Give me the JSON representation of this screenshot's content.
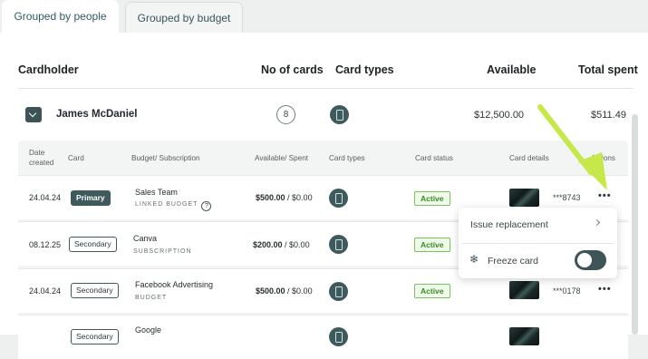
{
  "tabs": [
    {
      "label": "Grouped by people"
    },
    {
      "label": "Grouped by budget"
    }
  ],
  "table": {
    "headers": {
      "cardholder": "Cardholder",
      "no_of_cards": "No of cards",
      "card_types": "Card types",
      "available": "Available",
      "total_spent": "Total spent"
    }
  },
  "cardholder": {
    "name": "James McDaniel",
    "card_count": "8",
    "available": "$12,500.00",
    "total_spent": "$511.49"
  },
  "subtable": {
    "headers": {
      "date_created_1": "Date",
      "date_created_2": "created",
      "card": "Card",
      "budget_subscription": "Budget/ Subscription",
      "available_spent": "Available/ Spent",
      "card_types": "Card types",
      "card_status": "Card status",
      "card_details": "Card details",
      "actions": "Actions"
    },
    "rows": [
      {
        "date": "24.04.24",
        "card": "Primary",
        "budget": "Sales Team",
        "budget_type": "LINKED BUDGET",
        "help": "?",
        "available": "$500.00",
        "spent": " / $0.00",
        "status": "Active",
        "card_number": "***8743",
        "actions": "•••"
      },
      {
        "date": "08.12.25",
        "card": "Secondary",
        "budget": "Canva",
        "budget_type": "SUBSCRIPTION",
        "available": "$200.00",
        "spent": " / $0.00",
        "status": "Active"
      },
      {
        "date": "24.04.24",
        "card": "Secondary",
        "budget": "Facebook Advertising",
        "budget_type": "BUDGET",
        "available": "$500.00",
        "spent": " / $0.00",
        "status": "Active",
        "card_number": "***0178",
        "actions": "•••"
      },
      {
        "date": "",
        "card": "Secondary",
        "budget": "Google",
        "budget_type": "",
        "available": "",
        "spent": "",
        "status": ""
      }
    ]
  },
  "actions_menu": {
    "issue_replacement": "Issue replacement",
    "freeze_card": "Freeze card",
    "freeze_icon": "❄",
    "freeze_enabled": false
  },
  "colors": {
    "accent": "#3f5a5d",
    "active_green": "#3b8a2a",
    "annotation_arrow": "#c6e84a"
  }
}
